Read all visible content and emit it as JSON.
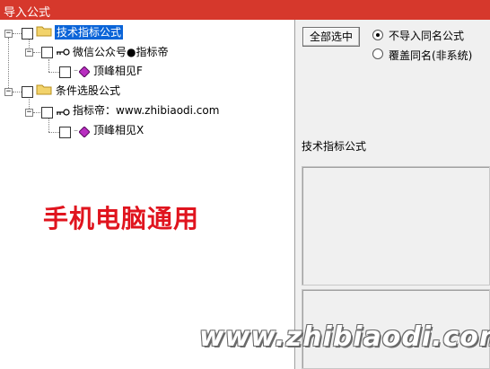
{
  "window": {
    "title": "导入公式"
  },
  "tree": {
    "nodes": [
      {
        "label": "技术指标公式",
        "selected": true
      },
      {
        "label": "微信公众号●指标帝"
      },
      {
        "label": "顶峰相见F"
      },
      {
        "label": "条件选股公式"
      },
      {
        "label": "指标帝：www.zhibiaodi.com"
      },
      {
        "label": "顶峰相见X"
      }
    ]
  },
  "overlay": {
    "slogan": "手机电脑通用",
    "site": "www.zhibiaodi.com"
  },
  "options": {
    "select_all_label": "全部选中",
    "radios": [
      {
        "label": "不导入同名公式",
        "checked": true
      },
      {
        "label": "覆盖同名(非系统)",
        "checked": false
      }
    ]
  },
  "description": {
    "label": "技术指标公式"
  },
  "colors": {
    "titlebar": "#d6382c",
    "selection": "#0a64d8",
    "slogan": "#e0141e"
  }
}
